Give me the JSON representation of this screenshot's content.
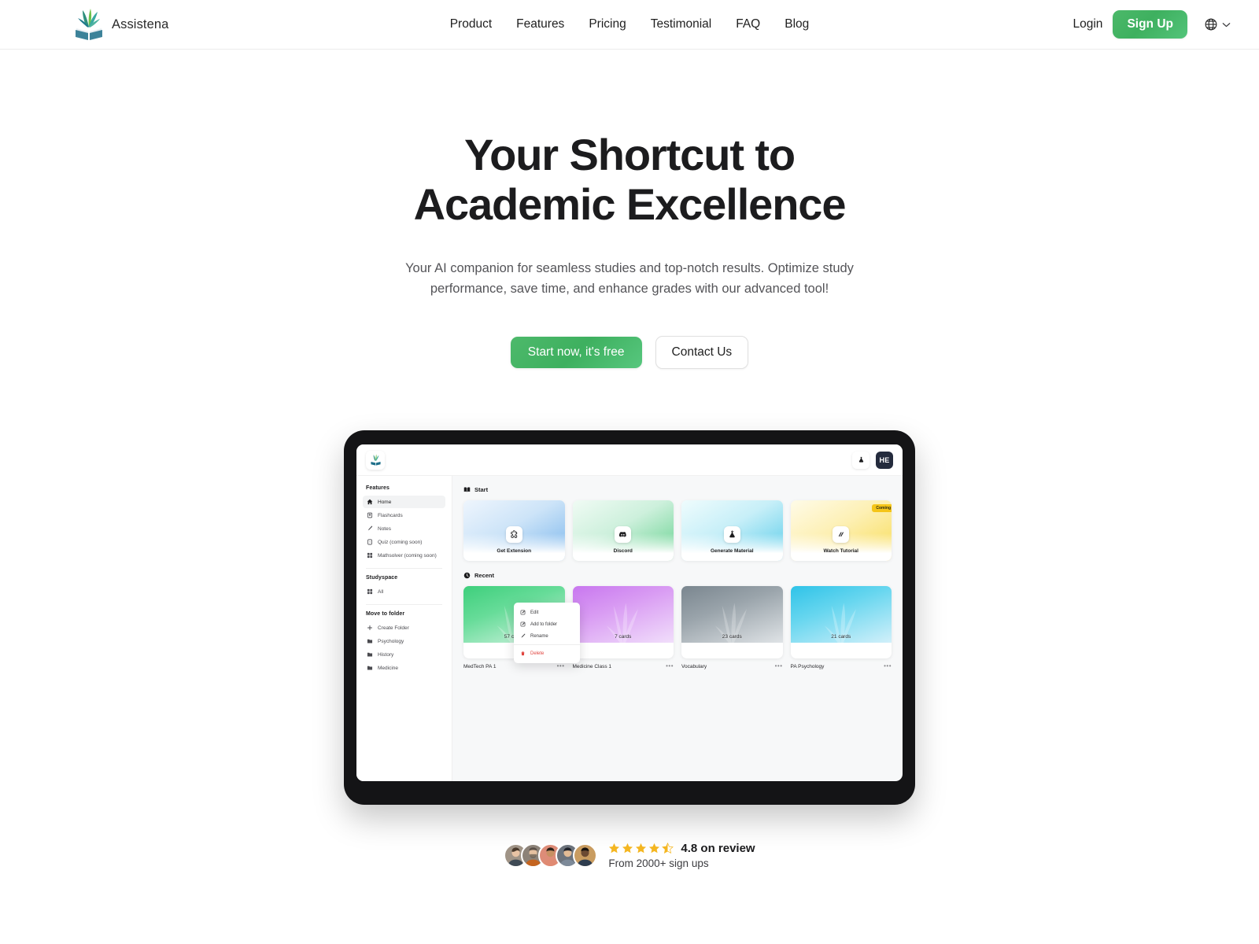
{
  "brand": {
    "name": "Assistena",
    "logo_icon": "book-leaf-logo"
  },
  "nav": {
    "links": [
      {
        "label": "Product",
        "name": "nav-link-product"
      },
      {
        "label": "Features",
        "name": "nav-link-features"
      },
      {
        "label": "Pricing",
        "name": "nav-link-pricing"
      },
      {
        "label": "Testimonial",
        "name": "nav-link-testimonial"
      },
      {
        "label": "FAQ",
        "name": "nav-link-faq"
      },
      {
        "label": "Blog",
        "name": "nav-link-blog"
      }
    ],
    "login_label": "Login",
    "signup_label": "Sign Up",
    "language_icon": "globe-icon",
    "language_chevron_icon": "chevron-down-icon"
  },
  "hero": {
    "title_line1": "Your Shortcut to",
    "title_line2": "Academic Excellence",
    "subtitle_line1": "Your AI companion for seamless studies and top-notch results. Optimize",
    "subtitle_line2": "study performance, save time, and enhance grades with our advanced tool!",
    "primary_cta": "Start now, it's free",
    "secondary_cta": "Contact Us"
  },
  "app_preview": {
    "topbar": {
      "logo_icon": "book-leaf-logo",
      "flask_icon": "flask-icon",
      "avatar_initials": "HE"
    },
    "sidebar": {
      "features_heading": "Features",
      "features_items": [
        {
          "label": "Home",
          "icon": "home-icon",
          "active": true
        },
        {
          "label": "Flashcards",
          "icon": "flashcards-icon",
          "active": false
        },
        {
          "label": "Notes",
          "icon": "pen-icon",
          "active": false
        },
        {
          "label": "Quiz (coming soon)",
          "icon": "quiz-icon",
          "active": false
        },
        {
          "label": "Mathsolver (coming soon)",
          "icon": "grid-icon",
          "active": false
        }
      ],
      "studyspace_heading": "Studyspace",
      "studyspace_items": [
        {
          "label": "All",
          "icon": "grid-icon"
        }
      ],
      "folder_heading": "Move to folder",
      "folder_items": [
        {
          "label": "Create Folder",
          "icon": "plus-icon"
        },
        {
          "label": "Psychology",
          "icon": "folder-icon"
        },
        {
          "label": "History",
          "icon": "folder-icon"
        },
        {
          "label": "Medicine",
          "icon": "folder-icon"
        }
      ]
    },
    "start": {
      "heading": "Start",
      "heading_icon": "book-icon",
      "cards": [
        {
          "label": "Get Extension",
          "icon": "puzzle-icon",
          "gradient_from": "#e9f2fc",
          "gradient_to": "#7ab6ec",
          "badge": ""
        },
        {
          "label": "Discord",
          "icon": "discord-icon",
          "gradient_from": "#eafaf0",
          "gradient_to": "#5fd08a",
          "badge": ""
        },
        {
          "label": "Generate Material",
          "icon": "flask-icon",
          "gradient_from": "#e8fbfc",
          "gradient_to": "#53c9e8",
          "badge": ""
        },
        {
          "label": "Watch Tutorial",
          "icon": "play-lines-icon",
          "gradient_from": "#fdf6dd",
          "gradient_to": "#f7d84a",
          "badge": "Coming"
        }
      ]
    },
    "recent": {
      "heading": "Recent",
      "heading_icon": "clock-icon",
      "cards": [
        {
          "title": "MedTech PA 1",
          "count": "57 cards",
          "color_from": "#41d07e",
          "color_to": "#bdf0d3"
        },
        {
          "title": "Medicine Class 1",
          "count": "7 cards",
          "color_from": "#c97ef0",
          "color_to": "#ecd4f7"
        },
        {
          "title": "Vocabulary",
          "count": "23 cards",
          "color_from": "#7d8a95",
          "color_to": "#d4dade"
        },
        {
          "title": "PA Psychology",
          "count": "21 cards",
          "color_from": "#33c4e8",
          "color_to": "#c3ecf7"
        }
      ],
      "menu_dots": "•••"
    },
    "context_menu": [
      {
        "label": "Edit",
        "icon": "edit-icon"
      },
      {
        "label": "Add to folder",
        "icon": "add-folder-icon"
      },
      {
        "label": "Rename",
        "icon": "rename-icon"
      },
      {
        "label": "Delete",
        "icon": "trash-icon"
      }
    ]
  },
  "review": {
    "rating_text": "4.8 on review",
    "signups_text": "From 2000+ sign ups",
    "stars_full": 4,
    "stars_half": 1,
    "star_color": "#f5b722",
    "avatar_colors": [
      "#9a8f82",
      "#8c8278",
      "#dd8c78",
      "#6c737c",
      "#c99c60"
    ]
  },
  "colors": {
    "accent_green": "#3eb05f",
    "text_primary": "#1c1c1e",
    "text_muted": "#545458"
  }
}
